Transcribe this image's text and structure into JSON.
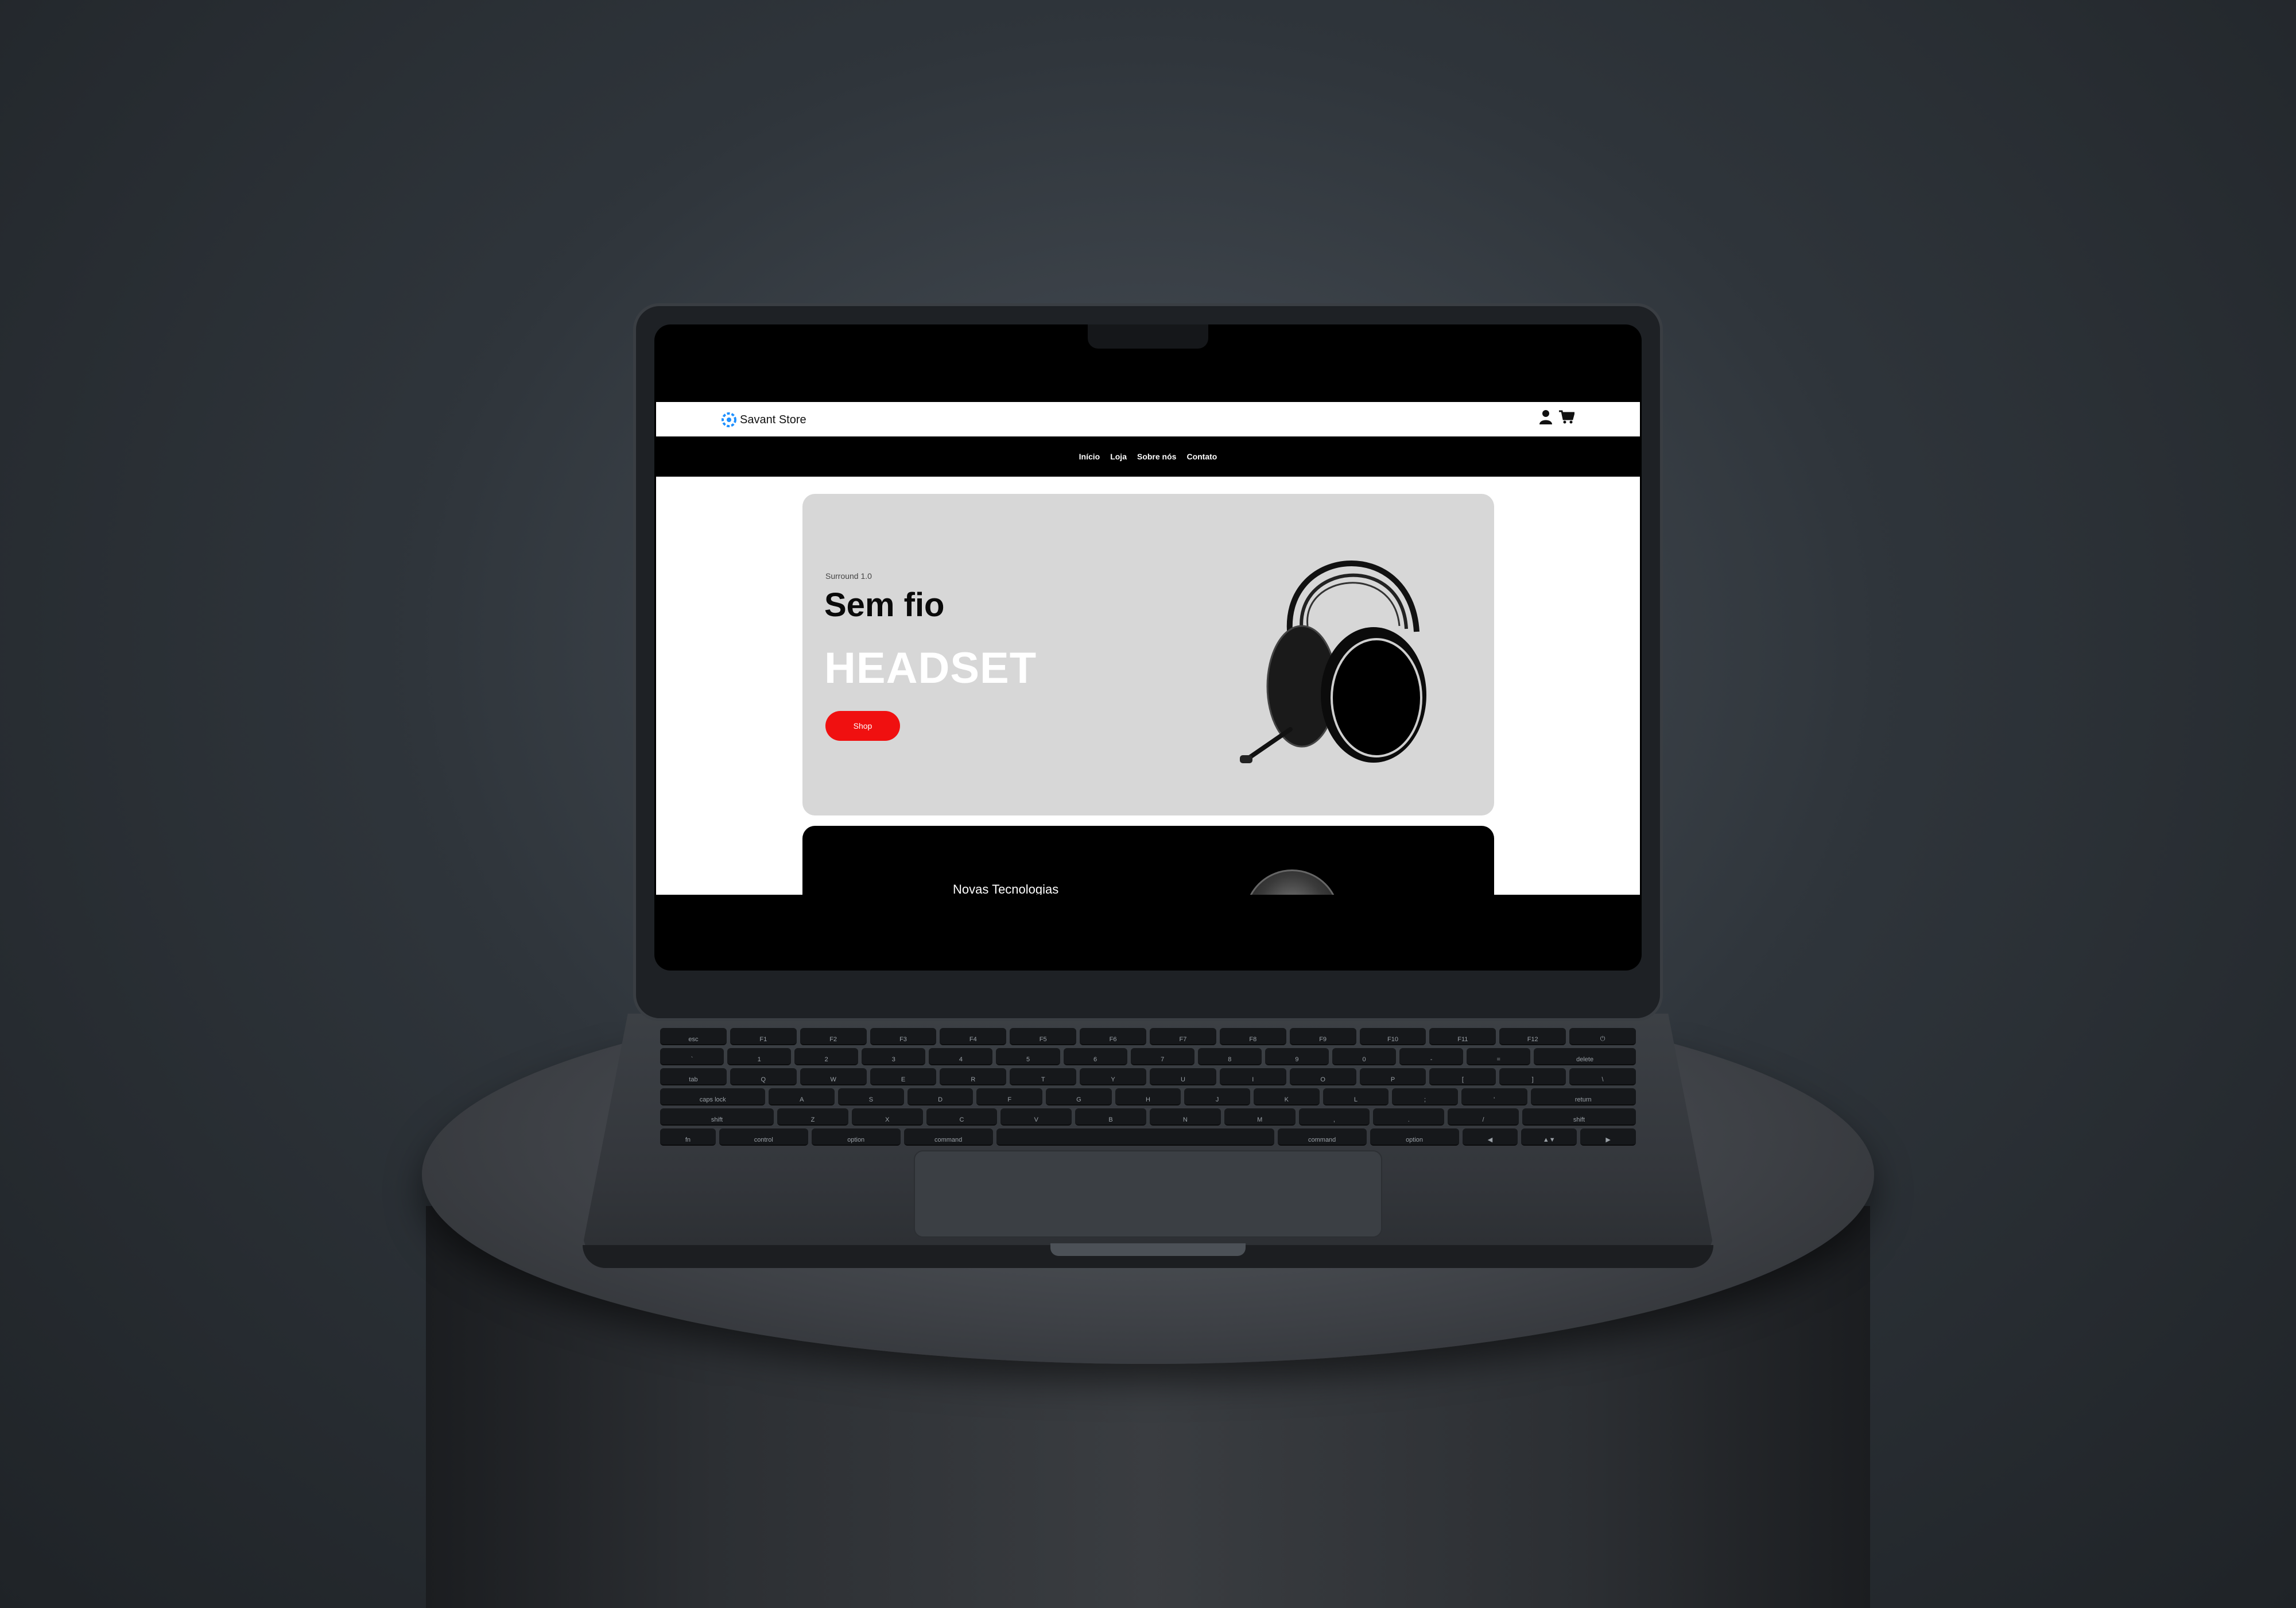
{
  "site": {
    "brand": "Savant Store",
    "nav": [
      "Início",
      "Loja",
      "Sobre nós",
      "Contato"
    ],
    "header_icons": [
      "user-icon",
      "cart-icon"
    ]
  },
  "hero": {
    "eyebrow": "Surround 1.0",
    "subtitle": "Sem fio",
    "title": "HEADSET",
    "button_label": "Shop",
    "image_icon": "headset-image"
  },
  "promo": {
    "title": "Novas Tecnologias"
  },
  "colors": {
    "accent": "#f01010",
    "hero_bg": "#d7d7d7",
    "nav_bg": "#000000"
  },
  "keyboard": {
    "rows": [
      [
        "esc",
        "F1",
        "F2",
        "F3",
        "F4",
        "F5",
        "F6",
        "F7",
        "F8",
        "F9",
        "F10",
        "F11",
        "F12",
        "⏻"
      ],
      [
        "`",
        "1",
        "2",
        "3",
        "4",
        "5",
        "6",
        "7",
        "8",
        "9",
        "0",
        "-",
        "=",
        "delete"
      ],
      [
        "tab",
        "Q",
        "W",
        "E",
        "R",
        "T",
        "Y",
        "U",
        "I",
        "O",
        "P",
        "[",
        "]",
        "\\"
      ],
      [
        "caps lock",
        "A",
        "S",
        "D",
        "F",
        "G",
        "H",
        "J",
        "K",
        "L",
        ";",
        "'",
        "return"
      ],
      [
        "shift",
        "Z",
        "X",
        "C",
        "V",
        "B",
        "N",
        "M",
        ",",
        ".",
        "/",
        "shift"
      ],
      [
        "fn",
        "control",
        "option",
        "command",
        "",
        "command",
        "option",
        "◀",
        "▲▼",
        "▶"
      ]
    ]
  }
}
